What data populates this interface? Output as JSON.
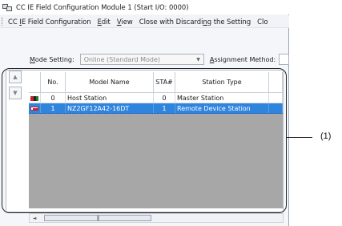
{
  "window": {
    "title": "CC IE Field Configuration Module 1 (Start I/O: 0000)"
  },
  "menu": {
    "items": [
      {
        "pre": "CC ",
        "u": "I",
        "post": "E Field Configuration"
      },
      {
        "pre": "",
        "u": "E",
        "post": "dit"
      },
      {
        "pre": "",
        "u": "V",
        "post": "iew"
      },
      {
        "pre": "Close with Discardi",
        "u": "n",
        "post": "g the Setting"
      },
      {
        "pre": "Clo",
        "u": "",
        "post": ""
      }
    ]
  },
  "mode": {
    "label_u": "M",
    "label_rest": "ode Setting:",
    "value": "Online (Standard Mode)",
    "assignment_label_u": "A",
    "assignment_label_rest": "ssignment Method:"
  },
  "grid": {
    "columns": [
      "",
      "No.",
      "Model Name",
      "STA#",
      "Station Type"
    ],
    "rows": [
      {
        "icon": "master-station-icon",
        "no": "0",
        "model": "Host Station",
        "sta": "0",
        "type": "Master Station",
        "selected": false
      },
      {
        "icon": "remote-device-icon",
        "no": "1",
        "model": "NZ2GF12A42-16DT",
        "sta": "1",
        "type": "Remote Device Station",
        "selected": true
      }
    ]
  },
  "annotation": {
    "label": "(1)"
  }
}
